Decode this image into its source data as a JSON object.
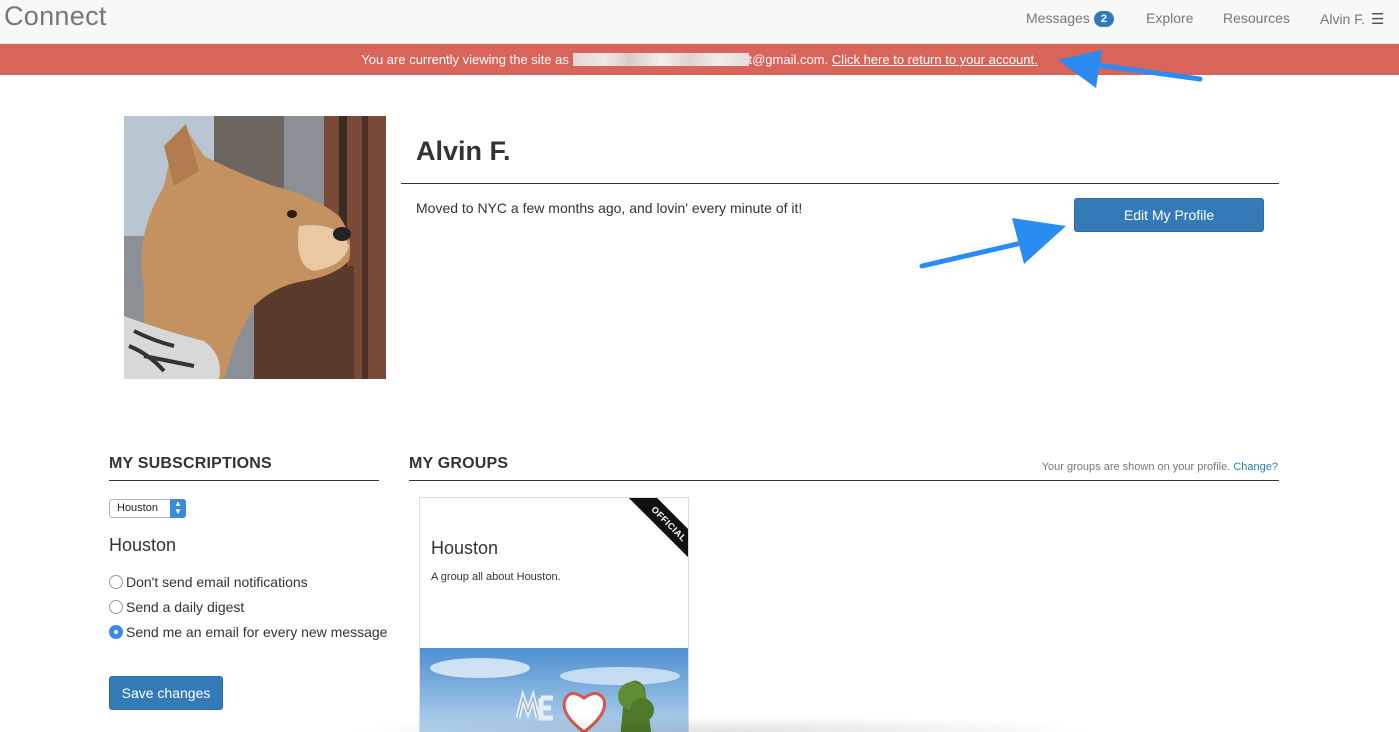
{
  "navbar": {
    "brand": "Connect",
    "messages_label": "Messages",
    "messages_count": "2",
    "explore_label": "Explore",
    "resources_label": "Resources",
    "user_label": "Alvin F.",
    "menu_icon": "hamburger-icon"
  },
  "alert": {
    "text_before": "You are currently viewing the site as ",
    "email_visible_part": "t@gmail.com.",
    "link_text": "Click here to return to your account.",
    "background": "#d9645a"
  },
  "profile": {
    "name": "Alvin F.",
    "bio": "Moved to NYC a few months ago, and lovin' every minute of it!",
    "edit_button": "Edit My Profile"
  },
  "subscriptions": {
    "title": "MY SUBSCRIPTIONS",
    "selected_city": "Houston",
    "city_heading": "Houston",
    "options": [
      {
        "label": "Don't send email notifications",
        "checked": false
      },
      {
        "label": "Send a daily digest",
        "checked": false
      },
      {
        "label": "Send me an email for every new message",
        "checked": true
      }
    ],
    "save_button": "Save changes"
  },
  "groups": {
    "title": "MY GROUPS",
    "note": "Your groups are shown on your profile.",
    "change_link": "Change?",
    "cards": [
      {
        "ribbon": "OFFICIAL",
        "name": "Houston",
        "description": "A group all about Houston."
      }
    ]
  },
  "colors": {
    "primary": "#337ab7",
    "annotation_arrow": "#2a8cf0"
  }
}
